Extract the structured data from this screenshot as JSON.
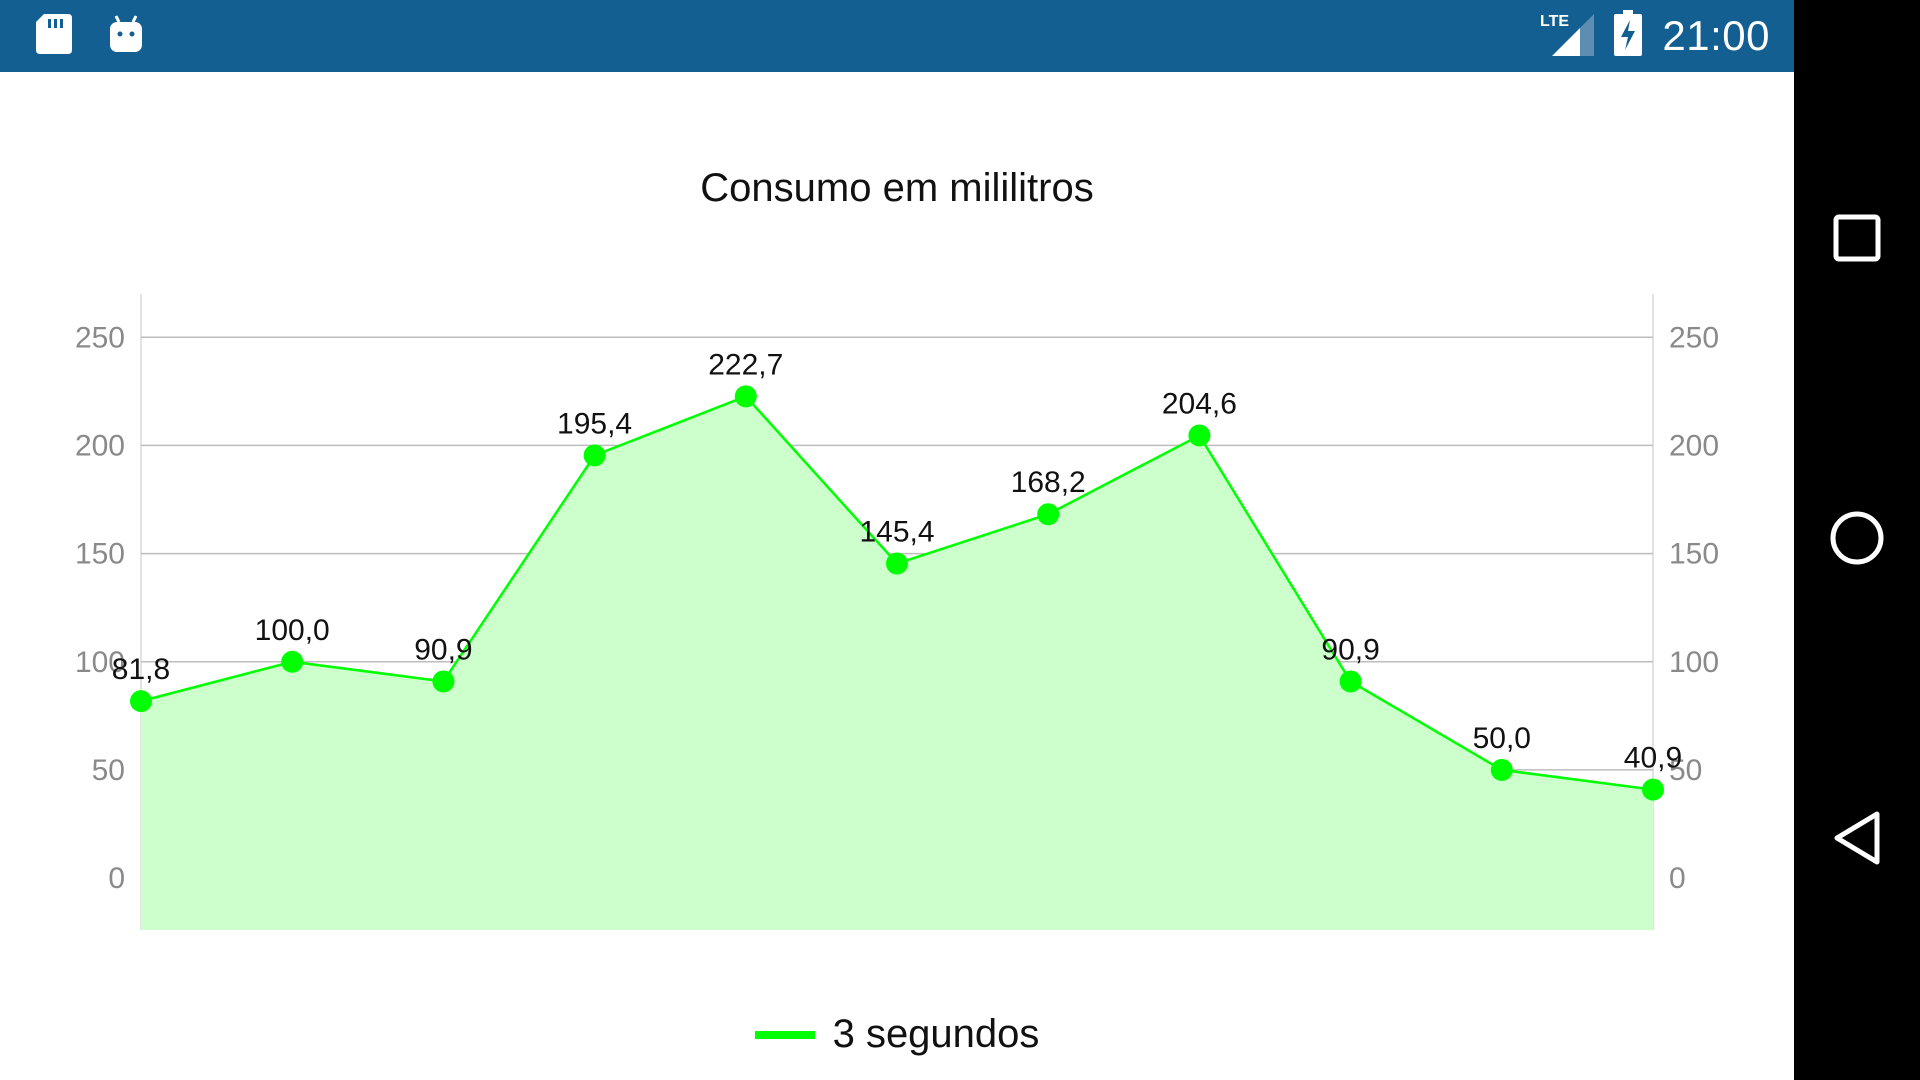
{
  "status_bar": {
    "time": "21:00",
    "network": "LTE",
    "icons": [
      "sd-card-icon",
      "android-debug-icon",
      "lte-signal-icon",
      "battery-charging-icon"
    ],
    "background": "#135f91"
  },
  "nav_bar": {
    "buttons": [
      "recents-icon",
      "home-icon",
      "back-icon"
    ]
  },
  "chart_data": {
    "type": "line",
    "title": "Consumo em mililitros",
    "x": [
      1,
      2,
      3,
      4,
      5,
      6,
      7,
      8,
      9,
      10,
      11
    ],
    "series": [
      {
        "name": "3 segundos",
        "values": [
          81.8,
          100.0,
          90.9,
          195.4,
          222.7,
          145.4,
          168.2,
          204.6,
          90.9,
          50.0,
          40.9
        ],
        "labels": [
          "81,8",
          "100,0",
          "90,9",
          "195,4",
          "222,7",
          "145,4",
          "168,2",
          "204,6",
          "90,9",
          "50,0",
          "40,9"
        ],
        "color": "#00ff00",
        "fill": "#ccffcc"
      }
    ],
    "ylim": [
      -24,
      270
    ],
    "yticks": [
      0,
      50,
      100,
      150,
      200,
      250
    ],
    "ytick_labels": [
      "0",
      "50",
      "100",
      "150",
      "200",
      "250"
    ],
    "axis_left": true,
    "axis_right": true,
    "grid": true,
    "legend_position": "bottom-center"
  }
}
